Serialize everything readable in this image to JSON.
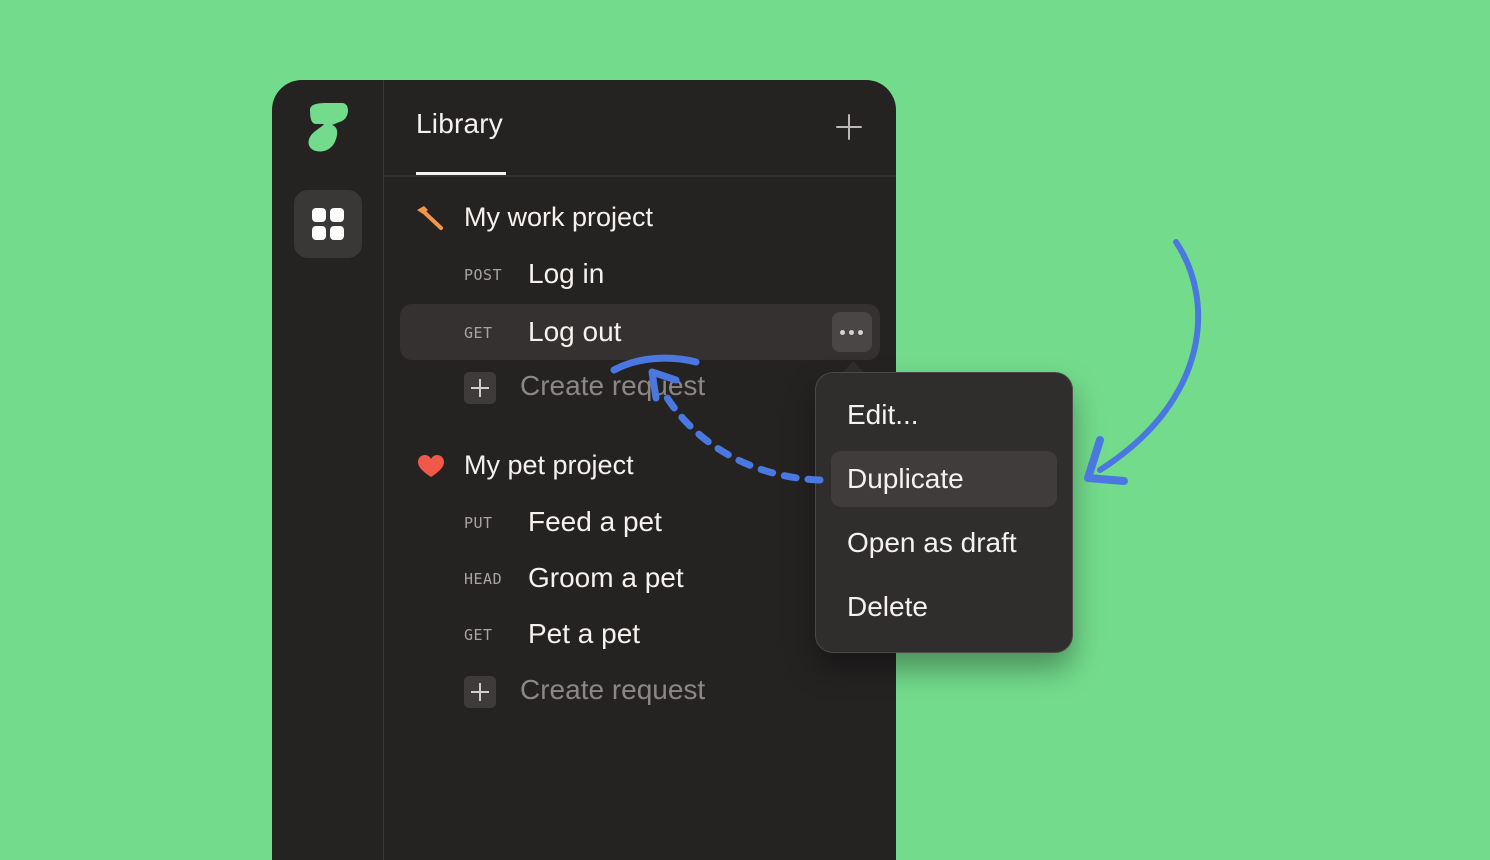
{
  "colors": {
    "background": "#73dc8c",
    "app": "#252222",
    "accent_logo": "#73dc8c",
    "arrow": "#4a78e0",
    "hammer": "#f2964a",
    "heart": "#f0584a"
  },
  "sidebar": {
    "logo_icon": "app-logo",
    "collections_icon": "grid-icon"
  },
  "header": {
    "tab_label": "Library",
    "add_icon": "plus-icon"
  },
  "projects": [
    {
      "icon": "hammer-icon",
      "name": "My work project",
      "requests": [
        {
          "method": "POST",
          "name": "Log in"
        },
        {
          "method": "GET",
          "name": "Log out"
        }
      ],
      "create_label": "Create request"
    },
    {
      "icon": "heart-icon",
      "name": "My pet project",
      "requests": [
        {
          "method": "PUT",
          "name": "Feed a pet"
        },
        {
          "method": "HEAD",
          "name": "Groom a pet"
        },
        {
          "method": "GET",
          "name": "Pet a pet"
        }
      ],
      "create_label": "Create request"
    }
  ],
  "context_menu": {
    "items": [
      "Edit...",
      "Duplicate",
      "Open as draft",
      "Delete"
    ],
    "highlighted": "Duplicate"
  }
}
